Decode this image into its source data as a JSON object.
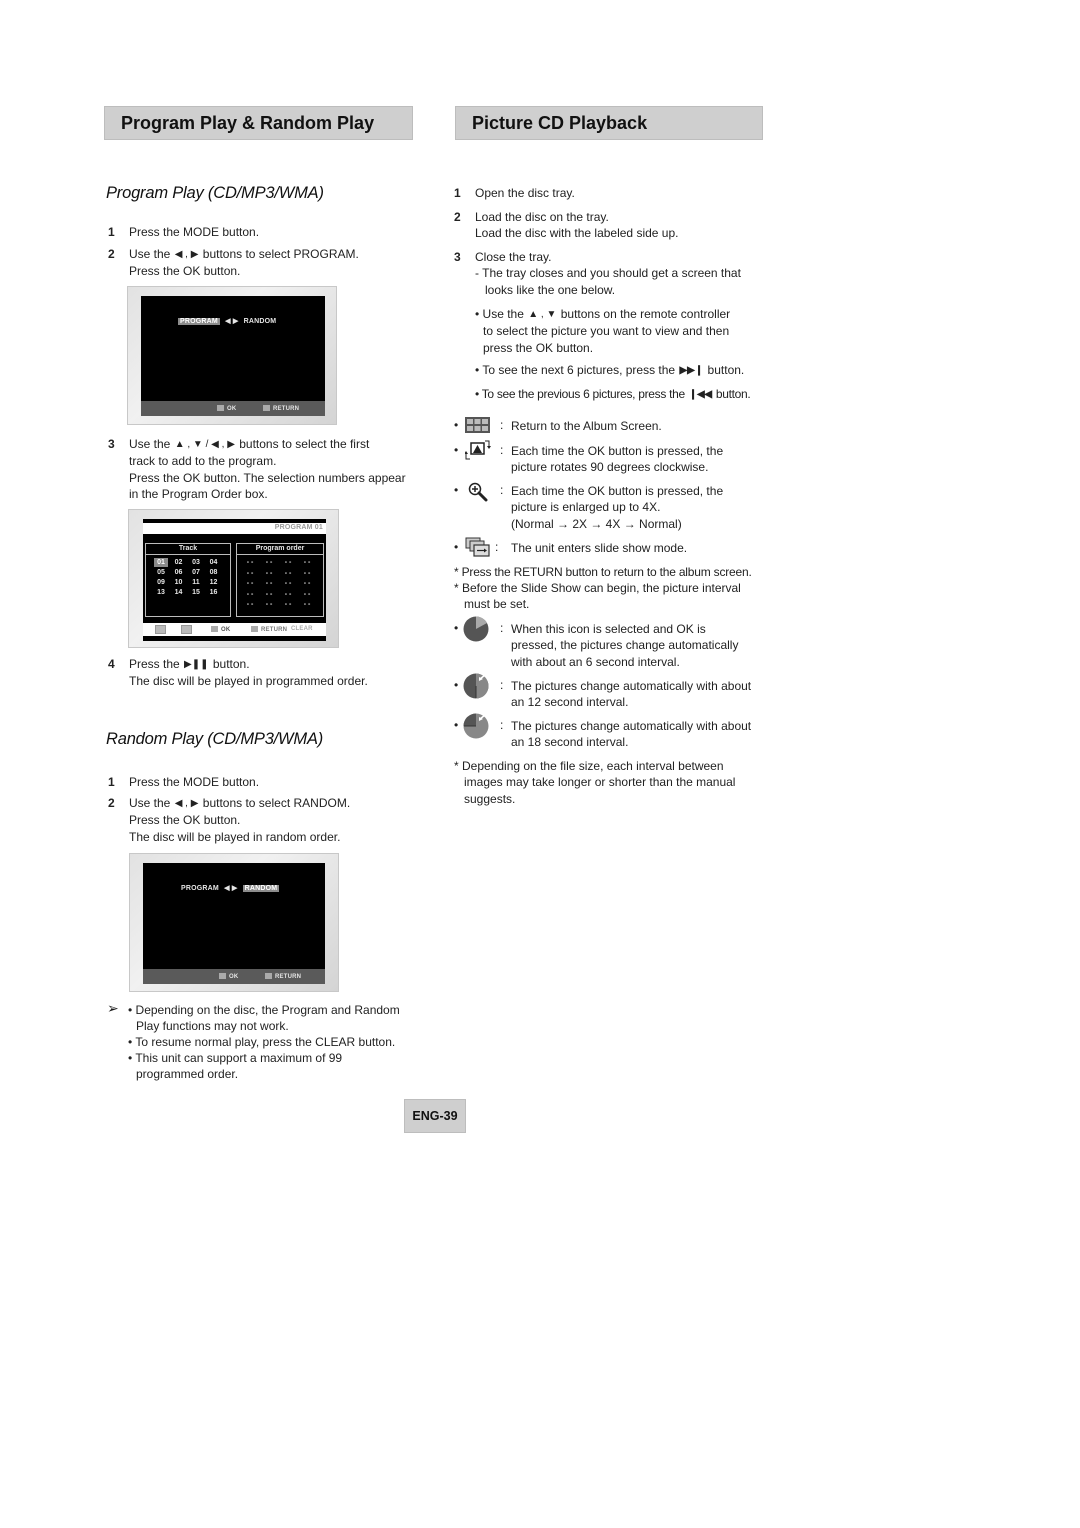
{
  "left": {
    "header": "Program Play & Random Play",
    "program": {
      "title": "Program Play (CD/MP3/WMA)",
      "steps": [
        {
          "num": "1",
          "lines": [
            "Press the MODE button."
          ]
        },
        {
          "num": "2",
          "pre": "Use the",
          "glyphs": "◀ , ▶",
          "post": "buttons to select PROGRAM.",
          "lines": [
            "Press the OK button."
          ]
        },
        {
          "num": "3",
          "pre": "Use the",
          "glyphs": "▲ , ▼  /  ◀ , ▶",
          "post": "buttons to select the first",
          "lines": [
            "track to add to the program.",
            "Press the OK button. The selection numbers appear",
            "in the Program Order box."
          ]
        },
        {
          "num": "4",
          "pre": "Press the",
          "glyphs": "▶❚❚",
          "post": "button.",
          "lines": [
            "The disc will be played in programmed order."
          ]
        }
      ],
      "screen1": {
        "program": "PROGRAM",
        "random": "RANDOM",
        "ok": "OK",
        "return": "RETURN",
        "selected": "PROGRAM"
      },
      "screen2": {
        "title": "PROGRAM 01",
        "track_header": "Track",
        "order_header": "Program  order",
        "tracks": [
          [
            "01",
            "02",
            "03",
            "04"
          ],
          [
            "05",
            "06",
            "07",
            "08"
          ],
          [
            "09",
            "10",
            "11",
            "12"
          ],
          [
            "13",
            "14",
            "15",
            "16"
          ]
        ],
        "selected_track": "01",
        "order_rows": [
          [
            "- -",
            "- -",
            "- -",
            "- -"
          ],
          [
            "- -",
            "- -",
            "- -",
            "- -"
          ],
          [
            "- -",
            "- -",
            "- -",
            "- -"
          ],
          [
            "- -",
            "- -",
            "- -",
            "- -"
          ],
          [
            "- -",
            "- -",
            "- -",
            "- -"
          ]
        ],
        "ok": "OK",
        "return": "RETURN",
        "clear": "CLEAR"
      }
    },
    "random": {
      "title": "Random Play (CD/MP3/WMA)",
      "steps": [
        {
          "num": "1",
          "lines": [
            "Press the MODE button."
          ]
        },
        {
          "num": "2",
          "pre": "Use the",
          "glyphs": "◀ , ▶",
          "post": "buttons to select RANDOM.",
          "lines": [
            "Press the OK button.",
            "The disc will be played in random order."
          ]
        }
      ],
      "screen3": {
        "program": "PROGRAM",
        "random": "RANDOM",
        "ok": "OK",
        "return": "RETURN",
        "selected": "RANDOM"
      }
    },
    "notes": {
      "marker": "➢",
      "items": [
        [
          "Depending on the disc, the Program and Random",
          "Play functions may not work."
        ],
        [
          "To resume normal play, press the CLEAR button."
        ],
        [
          "This unit can support a maximum of 99",
          "programmed order."
        ]
      ]
    }
  },
  "right": {
    "header": "Picture CD Playback",
    "steps": [
      {
        "num": "1",
        "lines": [
          "Open the disc tray."
        ]
      },
      {
        "num": "2",
        "lines": [
          "Load the disc on the tray.",
          "Load the disc with the labeled side up."
        ]
      },
      {
        "num": "3",
        "lines": [
          "Close the tray.",
          "- The tray closes and you should get a screen that",
          "  looks like the one below."
        ]
      }
    ],
    "bullets": [
      {
        "pre": "• Use the",
        "glyphs": "▲ , ▼",
        "post": "buttons on the remote   controller",
        "lines": [
          "to select the picture you want to view   and then",
          "press the OK button."
        ]
      },
      {
        "pre": "• To see the next 6 pictures, press the",
        "glyphs": "▶▶❙",
        "post": "button.",
        "lines": []
      },
      {
        "pre": "• To see the previous 6 pictures, press the",
        "glyphs": "❙◀◀",
        "post": "button.",
        "lines": []
      }
    ],
    "icon_items": [
      {
        "icon": "album-grid-icon",
        "lines": [
          "Return to the Album Screen."
        ]
      },
      {
        "icon": "rotate-picture-icon",
        "lines": [
          "Each time the OK button is pressed, the",
          "picture rotates 90 degrees clockwise."
        ]
      },
      {
        "icon": "zoom-in-icon",
        "lines": [
          "Each time the OK button is pressed, the",
          "picture is enlarged up to 4X.",
          "(Normal → 2X → 4X → Normal)"
        ]
      },
      {
        "icon": "slideshow-icon",
        "lines": [
          "The unit enters slide show mode."
        ]
      }
    ],
    "asterisk_notes": [
      [
        "* Press the RETURN button to return to the album screen."
      ],
      [
        "* Before the Slide Show can begin, the picture interval",
        "   must be set."
      ]
    ],
    "interval_items": [
      {
        "icon": "interval-6s-icon",
        "lines": [
          "When this icon is selected and OK is",
          "pressed, the pictures change automatically",
          "with about an 6 second interval."
        ]
      },
      {
        "icon": "interval-12s-icon",
        "lines": [
          "The pictures change automatically with about",
          "an 12 second interval."
        ]
      },
      {
        "icon": "interval-18s-icon",
        "lines": [
          "The pictures change automatically with about",
          "an 18 second interval."
        ]
      }
    ],
    "final_note": [
      "* Depending on the file size, each interval between",
      "   images may take longer or shorter than the manual",
      "   suggests."
    ]
  },
  "footer": {
    "page": "ENG-39"
  }
}
